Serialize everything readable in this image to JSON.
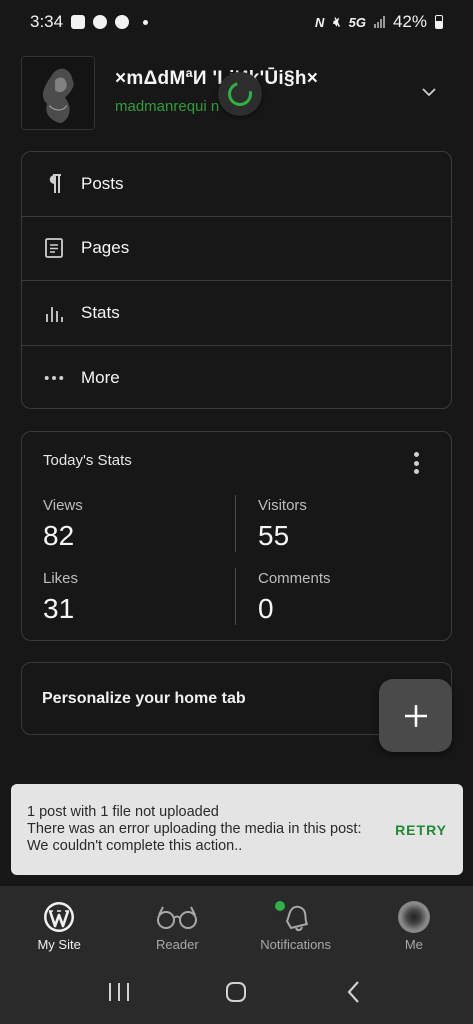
{
  "status_bar": {
    "time": "3:34",
    "network": "5G",
    "battery": "42%"
  },
  "site": {
    "title": "×mΔdMªИ    'LiИk'Ūi§h×",
    "url": "madmanrequi         n"
  },
  "menu": {
    "items": [
      {
        "label": "Posts",
        "icon": "paragraph-icon"
      },
      {
        "label": "Pages",
        "icon": "page-icon"
      },
      {
        "label": "Stats",
        "icon": "stats-icon"
      },
      {
        "label": "More",
        "icon": "more-dots-icon"
      }
    ]
  },
  "stats": {
    "title": "Today's Stats",
    "items": [
      {
        "label": "Views",
        "value": "82"
      },
      {
        "label": "Visitors",
        "value": "55"
      },
      {
        "label": "Likes",
        "value": "31"
      },
      {
        "label": "Comments",
        "value": "0"
      }
    ]
  },
  "personalize": {
    "label": "Personalize your home tab"
  },
  "snackbar": {
    "message": "1 post with 1 file not uploaded\nThere was an error uploading the media in this post: We couldn't complete this action..",
    "line1": "1 post with 1 file not uploaded",
    "line2": "There was an error uploading the media in this post: We couldn't complete this action..",
    "action": "RETRY"
  },
  "bottom_nav": {
    "items": [
      {
        "label": "My Site",
        "icon": "wordpress-icon",
        "active": true
      },
      {
        "label": "Reader",
        "icon": "glasses-icon",
        "active": false
      },
      {
        "label": "Notifications",
        "icon": "bell-icon",
        "active": false
      },
      {
        "label": "Me",
        "icon": "avatar",
        "active": false
      }
    ]
  },
  "colors": {
    "background": "#171717",
    "accent_green": "#2eb146",
    "link_green": "#2e9c3b",
    "border": "#3a3a3a",
    "nav_bg": "#2a2a2a",
    "snackbar_bg": "#e4e4e4"
  }
}
